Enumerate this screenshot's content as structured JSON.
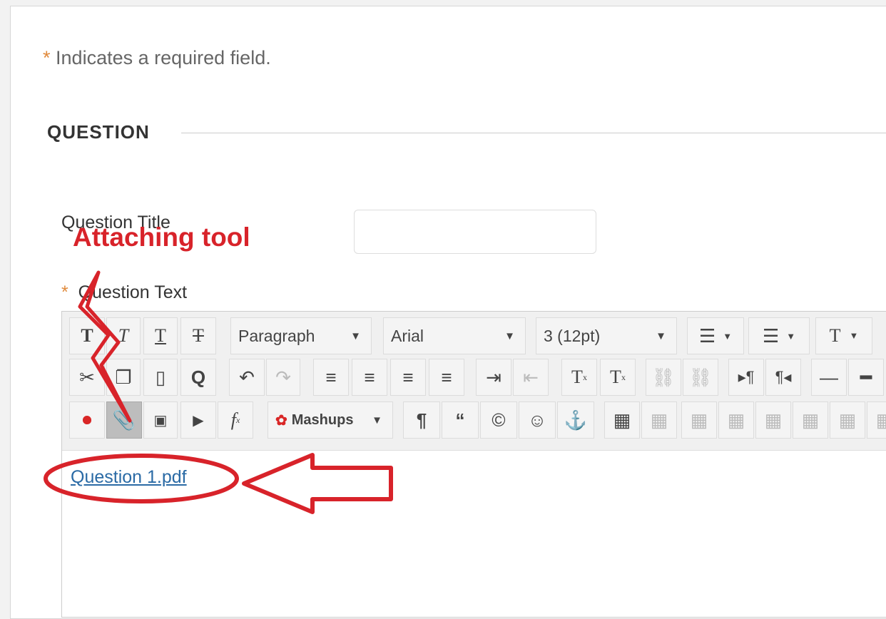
{
  "form": {
    "required_star": "*",
    "required_note": "Indicates a required field.",
    "section_title": "QUESTION",
    "question_title_label": "Question Title",
    "question_title_value": "",
    "question_text_label": "Question Text"
  },
  "editor": {
    "paragraph": "Paragraph",
    "font": "Arial",
    "size": "3 (12pt)",
    "mashups": "Mashups",
    "dropdown_arrow": "▼",
    "attachment": "Question 1.pdf"
  },
  "annotation": {
    "label": "Attaching tool",
    "color": "#d8232a"
  },
  "icons": [
    "bold-icon",
    "italic-icon",
    "underline-icon",
    "strikethrough-icon",
    "bullet-list-icon",
    "numbered-list-icon",
    "text-color-icon",
    "cut-icon",
    "copy-icon",
    "paste-icon",
    "find-icon",
    "undo-icon",
    "redo-icon",
    "align-left-icon",
    "align-center-icon",
    "align-right-icon",
    "justify-icon",
    "indent-icon",
    "outdent-icon",
    "superscript-icon",
    "subscript-icon",
    "link-icon",
    "unlink-icon",
    "ltr-icon",
    "rtl-icon",
    "horizontal-rule-icon",
    "record-icon",
    "attach-file-icon",
    "image-icon",
    "media-icon",
    "math-icon",
    "paragraph-mark-icon",
    "quote-icon",
    "copyright-icon",
    "emoticon-icon",
    "anchor-icon",
    "table-icon"
  ]
}
